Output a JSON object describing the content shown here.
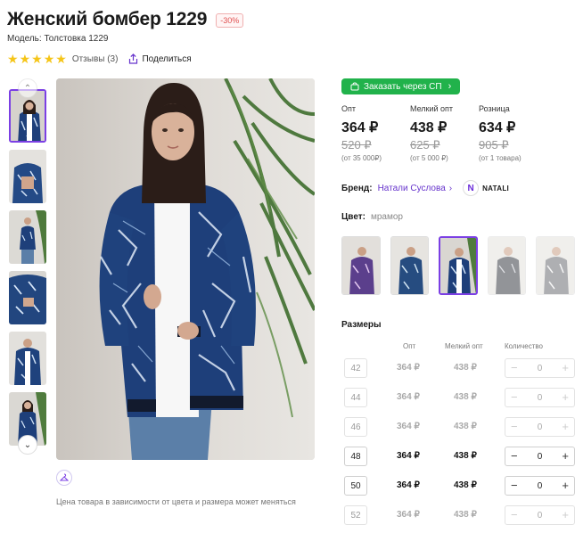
{
  "product": {
    "title": "Женский бомбер 1229",
    "discount_badge": "-30%",
    "model_label": "Модель: Толстовка 1229",
    "rating_stars": 5,
    "reviews_label": "Отзывы (3)",
    "share_label": "Поделиться"
  },
  "gallery": {
    "thumbnail_count": 6,
    "active_index": 0,
    "price_note": "Цена товара в зависимости от цвета и размера может меняться"
  },
  "purchase": {
    "sp_button_label": "Заказать через СП",
    "prices": [
      {
        "label": "Опт",
        "price": "364 ₽",
        "old_price": "520 ₽",
        "min": "(от 35 000₽)"
      },
      {
        "label": "Мелкий опт",
        "price": "438 ₽",
        "old_price": "625 ₽",
        "min": "(от 5 000 ₽)"
      },
      {
        "label": "Розница",
        "price": "634 ₽",
        "old_price": "905 ₽",
        "min": "(от 1 товара)"
      }
    ]
  },
  "brand": {
    "label": "Бренд:",
    "name": "Натали Суслова",
    "arrow": "›",
    "logo_letter": "N",
    "logo_text": "NATALI"
  },
  "color": {
    "label": "Цвет:",
    "value": "мрамор",
    "active_swatch": 2
  },
  "sizes": {
    "title": "Размеры",
    "headers": {
      "opt": "Опт",
      "small_opt": "Мелкий опт",
      "qty": "Количество"
    },
    "rows": [
      {
        "size": "42",
        "opt": "364 ₽",
        "small_opt": "438 ₽",
        "qty": "0",
        "available": false
      },
      {
        "size": "44",
        "opt": "364 ₽",
        "small_opt": "438 ₽",
        "qty": "0",
        "available": false
      },
      {
        "size": "46",
        "opt": "364 ₽",
        "small_opt": "438 ₽",
        "qty": "0",
        "available": false
      },
      {
        "size": "48",
        "opt": "364 ₽",
        "small_opt": "438 ₽",
        "qty": "0",
        "available": true
      },
      {
        "size": "50",
        "opt": "364 ₽",
        "small_opt": "438 ₽",
        "qty": "0",
        "available": true
      },
      {
        "size": "52",
        "opt": "364 ₽",
        "small_opt": "438 ₽",
        "qty": "0",
        "available": false
      }
    ],
    "minus": "−",
    "plus": "+"
  },
  "colors": {
    "accent": "#7b3fe4",
    "sp_green": "#21b24b",
    "star": "#f5c518",
    "jacket_navy": "#1e3f7a"
  }
}
